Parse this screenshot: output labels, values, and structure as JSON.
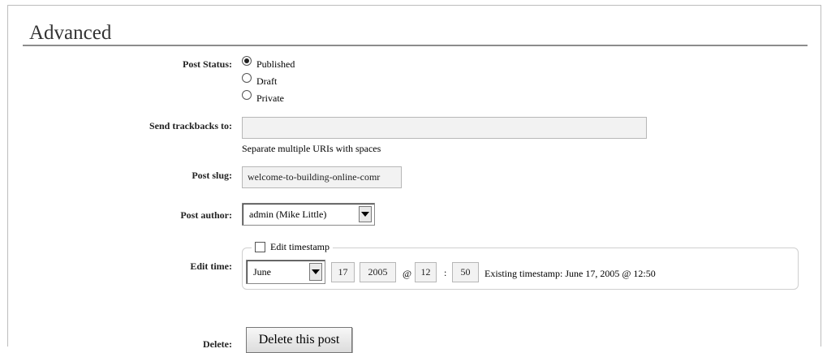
{
  "section": {
    "title": "Advanced"
  },
  "post_status": {
    "label": "Post Status:",
    "options": [
      {
        "label": "Published",
        "selected": true
      },
      {
        "label": "Draft",
        "selected": false
      },
      {
        "label": "Private",
        "selected": false
      }
    ]
  },
  "trackbacks": {
    "label": "Send trackbacks to:",
    "value": "",
    "hint": "Separate multiple URIs with spaces"
  },
  "slug": {
    "label": "Post slug:",
    "value": "welcome-to-building-online-comr"
  },
  "author": {
    "label": "Post author:",
    "selected": "admin (Mike Little)"
  },
  "edit_time": {
    "label": "Edit time:",
    "checkbox_label": "Edit timestamp",
    "checked": false,
    "month": "June",
    "day": "17",
    "year": "2005",
    "at": "@",
    "hour": "12",
    "colon": ":",
    "minute": "50",
    "existing": "Existing timestamp: June 17, 2005 @ 12:50"
  },
  "delete": {
    "label": "Delete:",
    "button": "Delete this post"
  },
  "colors": {
    "field_bg": "#f2f2f2",
    "rule": "#8c8c8c"
  }
}
